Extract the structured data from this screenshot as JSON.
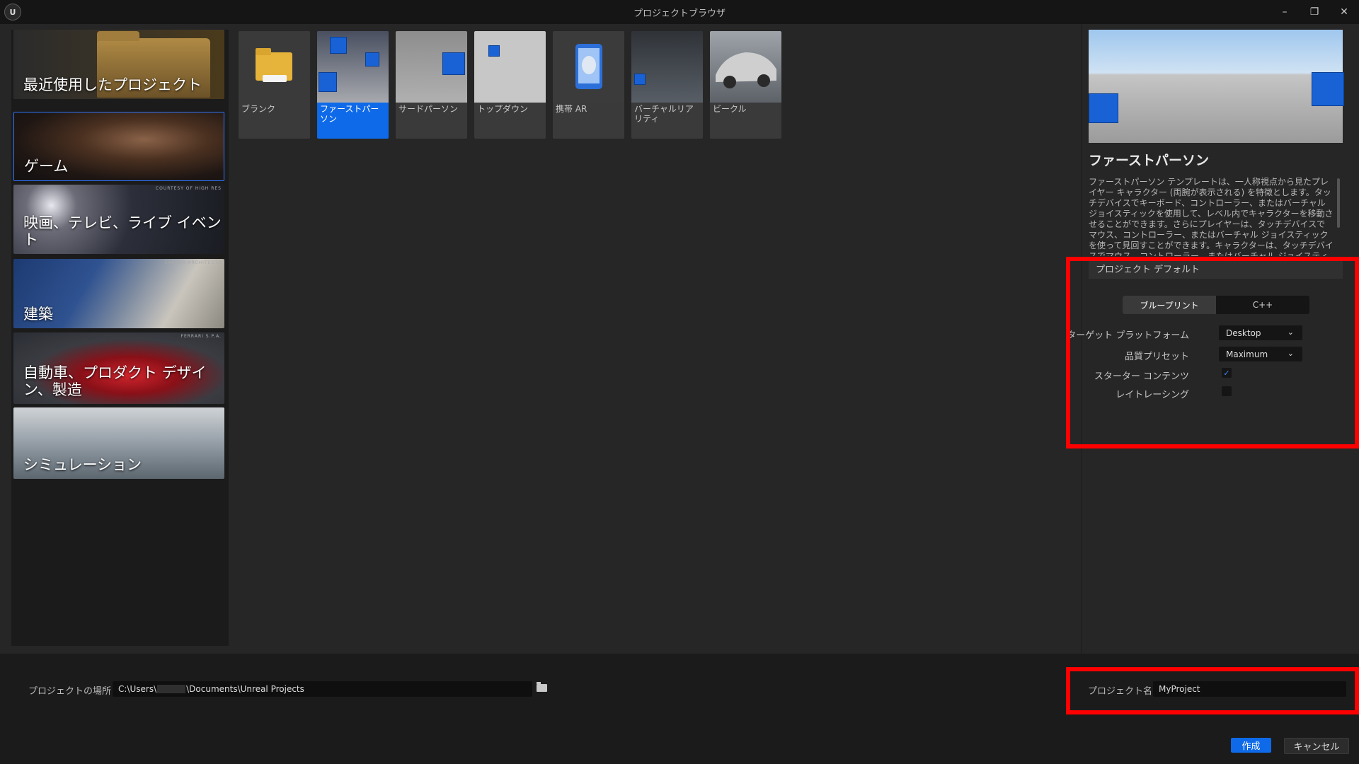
{
  "window": {
    "title": "プロジェクトブラウザ",
    "logo": "U",
    "minimize": "–",
    "restore": "❐",
    "close": "✕"
  },
  "categories": [
    {
      "label": "最近使用したプロジェクト",
      "credit": ""
    },
    {
      "label": "ゲーム",
      "credit": ""
    },
    {
      "label": "映画、テレビ、ライブ イベント",
      "credit": "COURTESY OF HIGH RES"
    },
    {
      "label": "建築",
      "credit": "CAPTUR ARCHITECTS"
    },
    {
      "label": "自動車、プロダクト デザイン、製造",
      "credit": "FERRARI S.P.A."
    },
    {
      "label": "シミュレーション",
      "credit": ""
    }
  ],
  "templates": [
    {
      "label": "ブランク"
    },
    {
      "label": "ファーストパーソン"
    },
    {
      "label": "サードパーソン"
    },
    {
      "label": "トップダウン"
    },
    {
      "label": "携帯 AR"
    },
    {
      "label": "バーチャルリアリティ"
    },
    {
      "label": "ビークル"
    }
  ],
  "details": {
    "title": "ファーストパーソン",
    "description": "ファーストパーソン テンプレートは、一人称視点から見たプレイヤー キャラクター (両腕が表示される) を特徴とします。タッチデバイスでキーボード、コントローラー、またはバーチャル ジョイスティックを使用して、レベル内でキャラクターを移動させることができます。さらにプレイヤーは、タッチデバイスでマウス、コントローラー、またはバーチャル ジョイスティックを使って見回すことができます。キャラクターは、タッチデバイスでマウス、コントローラー、またはバーチャル ジョイスティックを使用して",
    "defaults_header": "プロジェクト デフォルト",
    "blueprint": "ブループリント",
    "cpp": "C++",
    "platform_label": "ターゲット プラットフォーム",
    "platform_value": "Desktop",
    "quality_label": "品質プリセット",
    "quality_value": "Maximum",
    "starter_label": "スターター コンテンツ",
    "starter_checked": "✓",
    "raytracing_label": "レイトレーシング",
    "raytracing_checked": ""
  },
  "bottom": {
    "location_label": "プロジェクトの場所",
    "location_prefix": "C:\\Users\\",
    "location_suffix": "\\Documents\\Unreal Projects",
    "name_label": "プロジェクト名",
    "name_value": "MyProject",
    "create": "作成",
    "cancel": "キャンセル"
  },
  "colors": {
    "accent": "#0e6ae8",
    "highlight": "#ff0000"
  }
}
